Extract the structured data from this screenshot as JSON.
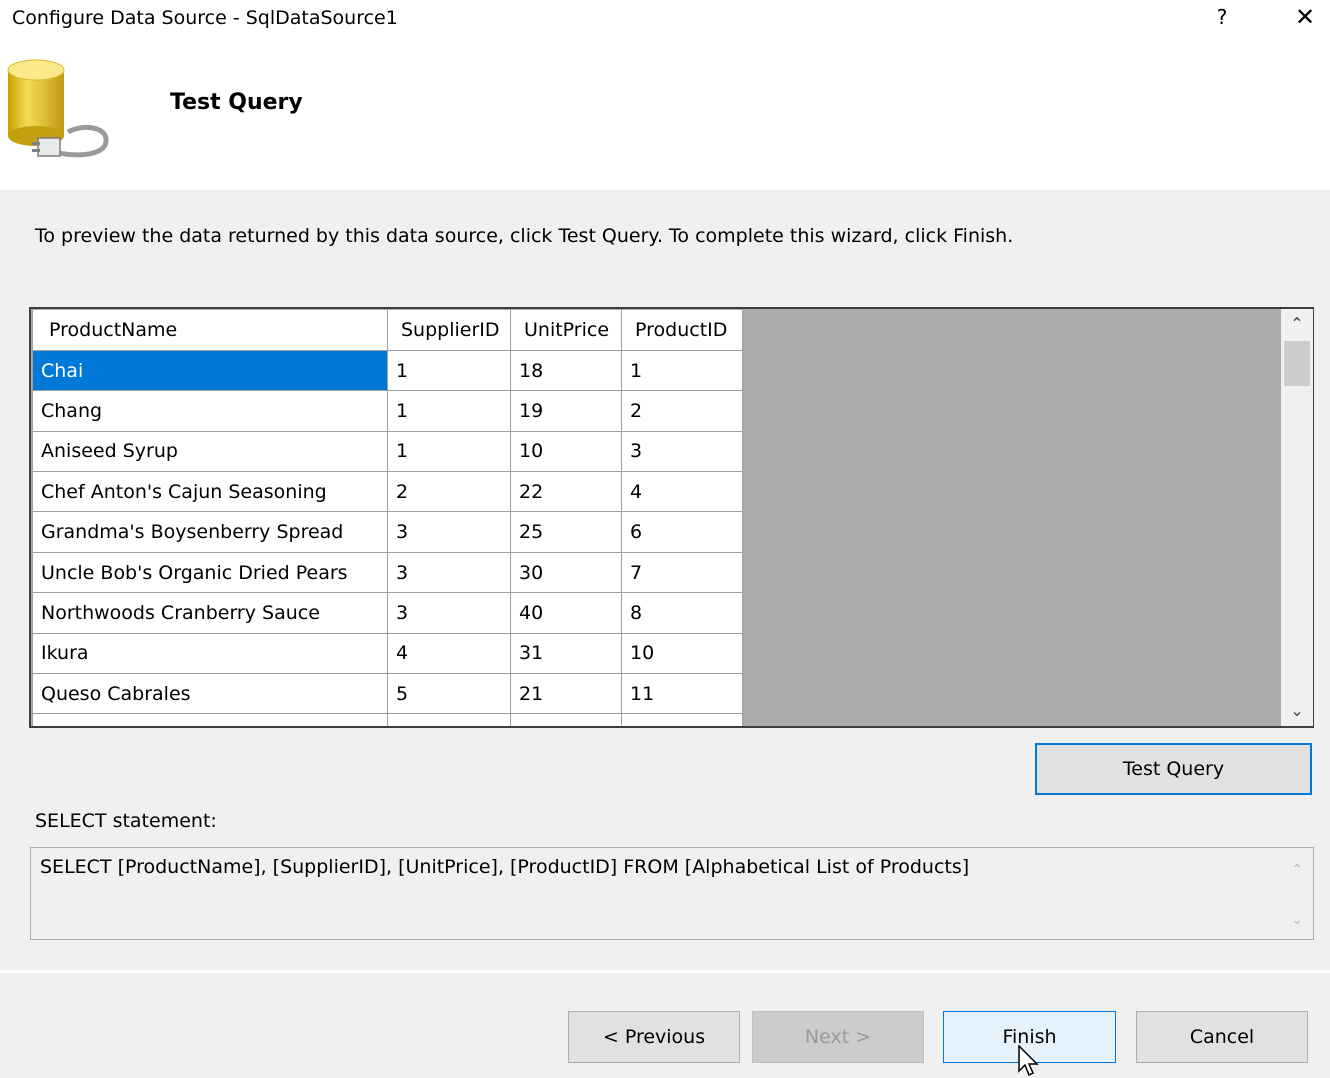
{
  "window": {
    "title": "Configure Data Source - SqlDataSource1",
    "help_label": "?",
    "close_label": "✕"
  },
  "header": {
    "title": "Test Query"
  },
  "instructions": "To preview the data returned by this data source, click Test Query. To complete this wizard, click Finish.",
  "grid": {
    "columns": [
      "ProductName",
      "SupplierID",
      "UnitPrice",
      "ProductID"
    ],
    "rows": [
      [
        "Chai",
        "1",
        "18",
        "1"
      ],
      [
        "Chang",
        "1",
        "19",
        "2"
      ],
      [
        "Aniseed Syrup",
        "1",
        "10",
        "3"
      ],
      [
        "Chef Anton's Cajun Seasoning",
        "2",
        "22",
        "4"
      ],
      [
        "Grandma's Boysenberry Spread",
        "3",
        "25",
        "6"
      ],
      [
        "Uncle Bob's Organic Dried Pears",
        "3",
        "30",
        "7"
      ],
      [
        "Northwoods Cranberry Sauce",
        "3",
        "40",
        "8"
      ],
      [
        "Ikura",
        "4",
        "31",
        "10"
      ],
      [
        "Queso Cabrales",
        "5",
        "21",
        "11"
      ]
    ],
    "selected_row": 0,
    "scroll_up": "⌃",
    "scroll_down": "⌄"
  },
  "buttons": {
    "test_query": "Test Query",
    "previous": "< Previous",
    "next": "Next >",
    "finish": "Finish",
    "cancel": "Cancel"
  },
  "select_statement": {
    "label": "SELECT statement:",
    "sql": "SELECT [ProductName], [SupplierID], [UnitPrice], [ProductID] FROM [Alphabetical List of Products]"
  },
  "colors": {
    "selection": "#0078d7",
    "dialog_background": "#f0f0f0",
    "grid_background": "#ababab"
  }
}
